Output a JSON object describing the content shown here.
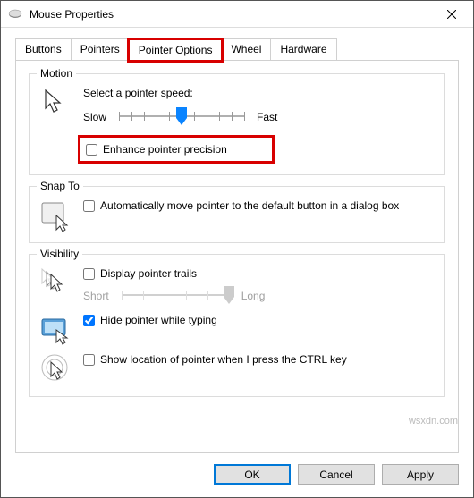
{
  "window": {
    "title": "Mouse Properties"
  },
  "tabs": {
    "buttons": "Buttons",
    "pointers": "Pointers",
    "pointer_options": "Pointer Options",
    "wheel": "Wheel",
    "hardware": "Hardware"
  },
  "motion": {
    "title": "Motion",
    "speed_label": "Select a pointer speed:",
    "slow": "Slow",
    "fast": "Fast",
    "enhance": "Enhance pointer precision"
  },
  "snap": {
    "title": "Snap To",
    "auto": "Automatically move pointer to the default button in a dialog box"
  },
  "visibility": {
    "title": "Visibility",
    "trails": "Display pointer trails",
    "short": "Short",
    "long": "Long",
    "hide": "Hide pointer while typing",
    "ctrl": "Show location of pointer when I press the CTRL key"
  },
  "buttons": {
    "ok": "OK",
    "cancel": "Cancel",
    "apply": "Apply"
  },
  "watermark": "wsxdn.com"
}
